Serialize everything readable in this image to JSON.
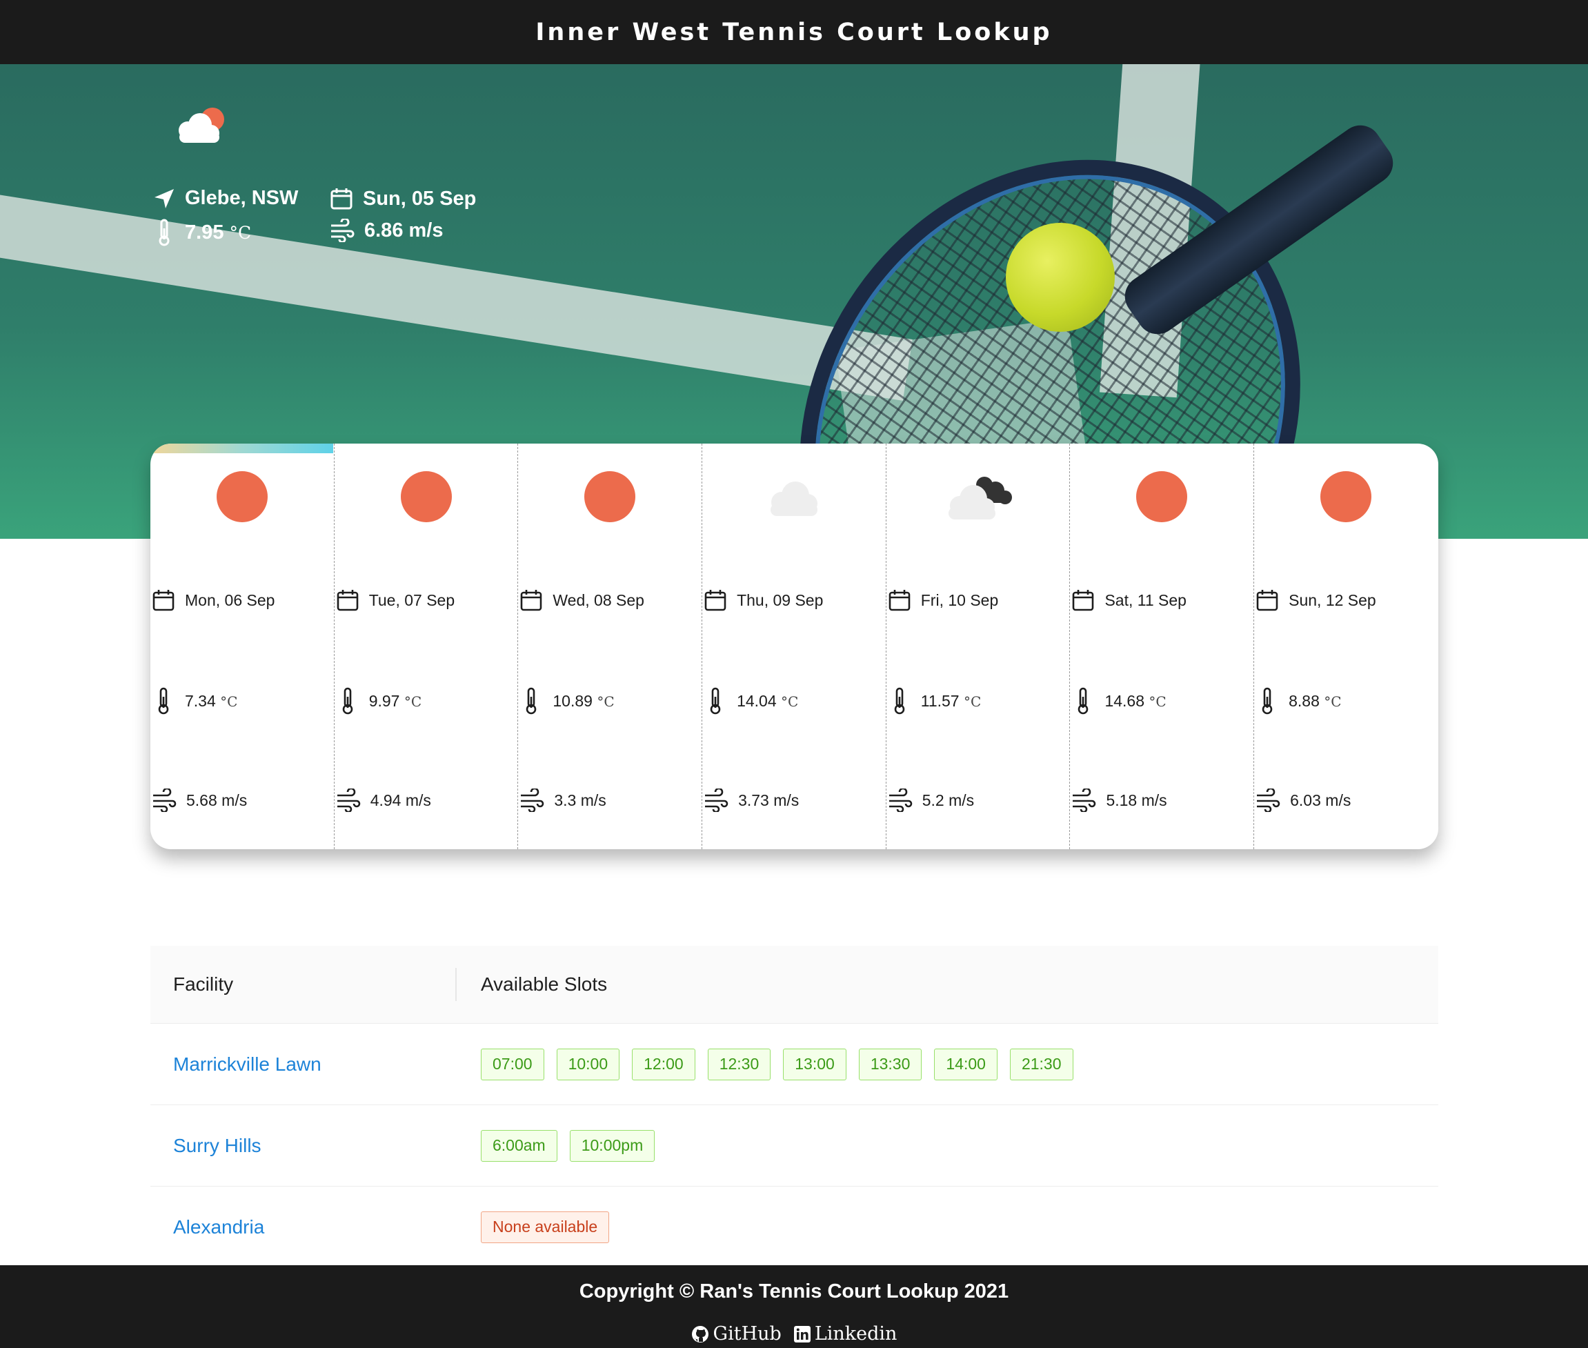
{
  "header": {
    "title": "Inner West Tennis Court Lookup"
  },
  "current": {
    "location": "Glebe, NSW",
    "date": "Sun, 05 Sep",
    "temperature": "7.95",
    "temp_unit": "°C",
    "wind": "6.86 m/s",
    "icon": "partly-cloudy-icon"
  },
  "forecast": [
    {
      "date": "Mon, 06 Sep",
      "temp": "7.34",
      "unit": "°C",
      "wind": "5.68 m/s",
      "icon": "sun-icon"
    },
    {
      "date": "Tue, 07 Sep",
      "temp": "9.97",
      "unit": "°C",
      "wind": "4.94 m/s",
      "icon": "sun-icon"
    },
    {
      "date": "Wed, 08 Sep",
      "temp": "10.89",
      "unit": "°C",
      "wind": "3.3 m/s",
      "icon": "sun-icon"
    },
    {
      "date": "Thu, 09 Sep",
      "temp": "14.04",
      "unit": "°C",
      "wind": "3.73 m/s",
      "icon": "cloud-icon"
    },
    {
      "date": "Fri, 10 Sep",
      "temp": "11.57",
      "unit": "°C",
      "wind": "5.2 m/s",
      "icon": "dark-cloud-icon"
    },
    {
      "date": "Sat, 11 Sep",
      "temp": "14.68",
      "unit": "°C",
      "wind": "5.18 m/s",
      "icon": "sun-icon"
    },
    {
      "date": "Sun, 12 Sep",
      "temp": "8.88",
      "unit": "°C",
      "wind": "6.03 m/s",
      "icon": "sun-icon"
    }
  ],
  "table": {
    "headers": [
      "Facility",
      "Available Slots"
    ],
    "rows": [
      {
        "facility": "Marrickville Lawn",
        "slots": [
          "07:00",
          "10:00",
          "12:00",
          "12:30",
          "13:00",
          "13:30",
          "14:00",
          "21:30"
        ]
      },
      {
        "facility": "Surry Hills",
        "slots": [
          "6:00am",
          "10:00pm"
        ]
      },
      {
        "facility": "Alexandria",
        "slots": [],
        "none_label": "None available"
      }
    ]
  },
  "footer": {
    "copyright": "Copyright © Ran's Tennis Court Lookup 2021",
    "github": "GitHub",
    "linkedin": "Linkedin"
  },
  "colors": {
    "accent_sun": "#ec6b4c",
    "link_blue": "#1d83d8",
    "slot_green": "#3c9b18",
    "none_red": "#c8401c",
    "bar_dark": "#1b1b1b"
  }
}
